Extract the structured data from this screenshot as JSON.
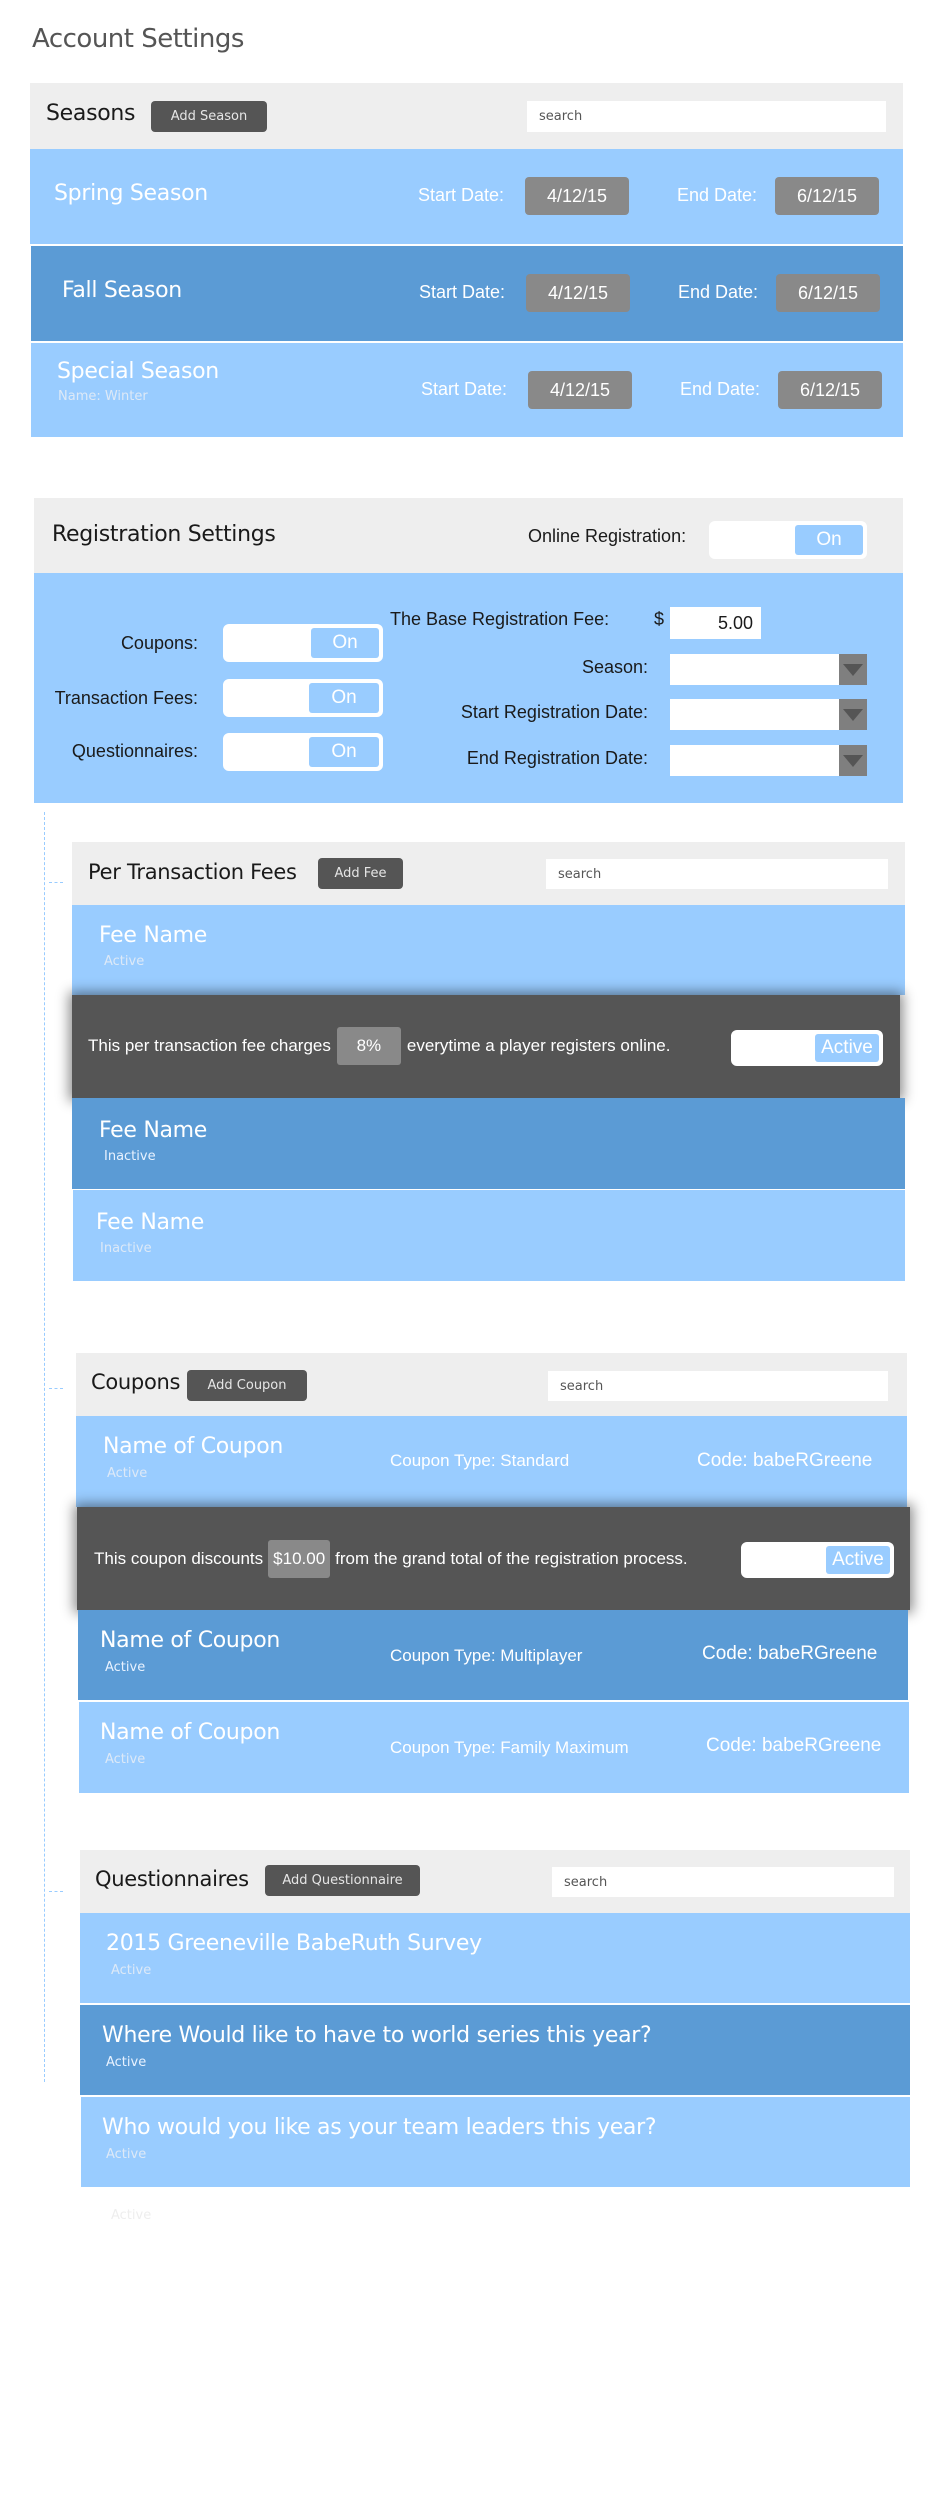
{
  "page": {
    "title": "Account Settings"
  },
  "seasons": {
    "title": "Seasons",
    "add_button": "Add Season",
    "search_placeholder": "search",
    "start_label": "Start Date:",
    "end_label": "End Date:",
    "items": [
      {
        "name": "Spring Season",
        "subtitle": "",
        "start": "4/12/15",
        "end": "6/12/15",
        "style": "light"
      },
      {
        "name": "Fall Season",
        "subtitle": "",
        "start": "4/12/15",
        "end": "6/12/15",
        "style": "dark"
      },
      {
        "name": "Special Season",
        "subtitle": "Name: Winter",
        "start": "4/12/15",
        "end": "6/12/15",
        "style": "light"
      }
    ]
  },
  "registration": {
    "title": "Registration Settings",
    "online_label": "Online Registration:",
    "online_state": "On",
    "toggles": [
      {
        "label": "Coupons:",
        "state": "On"
      },
      {
        "label": "Transaction Fees:",
        "state": "On"
      },
      {
        "label": "Questionnaires:",
        "state": "On"
      }
    ],
    "base_fee_label": "The Base Registration Fee:",
    "currency": "$",
    "base_fee_value": "5.00",
    "dropdowns": [
      {
        "label": "Season:",
        "value": ""
      },
      {
        "label": "Start Registration Date:",
        "value": ""
      },
      {
        "label": "End Registration Date:",
        "value": ""
      }
    ]
  },
  "fees": {
    "title": "Per Transaction Fees",
    "add_button": "Add Fee",
    "search_placeholder": "search",
    "items": [
      {
        "name": "Fee Name",
        "status": "Active"
      },
      {
        "name": "Fee Name",
        "status": "Inactive"
      },
      {
        "name": "Fee Name",
        "status": "Inactive"
      }
    ],
    "detail": {
      "prefix": "This per transaction fee charges",
      "value": "8%",
      "suffix": "everytime a player registers online.",
      "toggle_state": "Active"
    }
  },
  "coupons": {
    "title": "Coupons",
    "add_button": "Add Coupon",
    "search_placeholder": "search",
    "items": [
      {
        "name": "Name of Coupon",
        "status": "Active",
        "type": "Coupon Type: Standard",
        "code": "Code: babeRGreene"
      },
      {
        "name": "Name of Coupon",
        "status": "Active",
        "type": "Coupon Type: Multiplayer",
        "code": "Code: babeRGreene"
      },
      {
        "name": "Name of Coupon",
        "status": "Active",
        "type": "Coupon Type: Family Maximum",
        "code": "Code: babeRGreene"
      }
    ],
    "detail": {
      "prefix": "This coupon discounts",
      "value": "$10.00",
      "suffix": "from the grand total of the registration process.",
      "toggle_state": "Active"
    }
  },
  "questionnaires": {
    "title": "Questionnaires",
    "add_button": "Add Questionnaire",
    "search_placeholder": "search",
    "items": [
      {
        "name": "2015 Greeneville BabeRuth Survey",
        "status": "Active"
      },
      {
        "name": "Where Would like to have to world series this year?",
        "status": "Active"
      },
      {
        "name": "Who would you like as your team leaders this year?",
        "status": "Active"
      }
    ],
    "ghost_status": "Active"
  },
  "colors": {
    "light_row": "#99ccff",
    "dark_row": "#5b9bd5",
    "header_bg": "#eeeeee",
    "button_dark": "#555555",
    "chip_gray": "#898989"
  }
}
